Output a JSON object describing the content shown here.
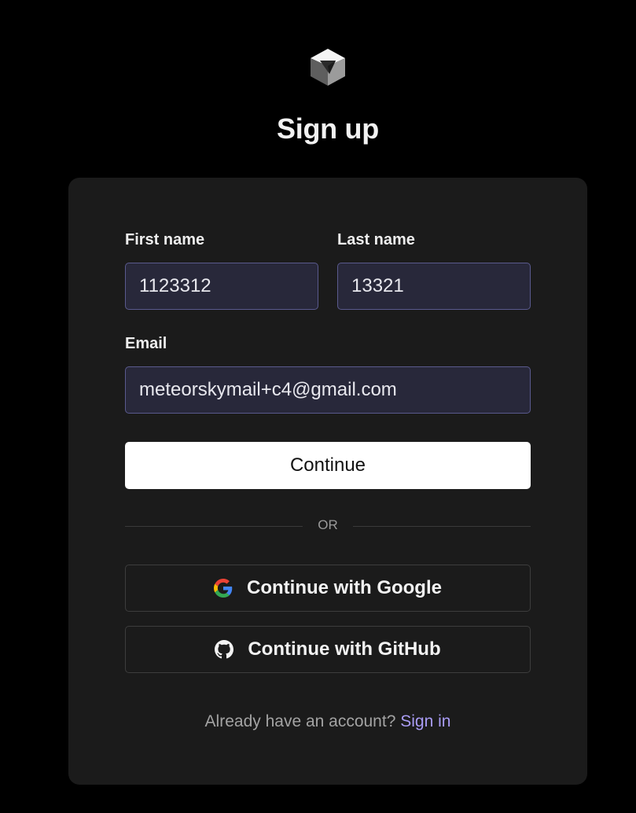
{
  "page": {
    "title": "Sign up"
  },
  "form": {
    "first_name": {
      "label": "First name",
      "value": "1123312"
    },
    "last_name": {
      "label": "Last name",
      "value": "13321"
    },
    "email": {
      "label": "Email",
      "value": "meteorskymail+c4@gmail.com"
    },
    "continue_label": "Continue",
    "divider_text": "OR"
  },
  "oauth": {
    "google_label": "Continue with Google",
    "github_label": "Continue with GitHub"
  },
  "footer": {
    "prompt": "Already have an account?",
    "link": "Sign in"
  },
  "icons": {
    "logo": "cube-logo-icon",
    "google": "google-icon",
    "github": "github-icon"
  },
  "colors": {
    "background": "#000000",
    "card": "#1b1b1b",
    "input_bg": "#28283a",
    "input_border": "#5a5a8e",
    "link": "#a99cf5"
  }
}
